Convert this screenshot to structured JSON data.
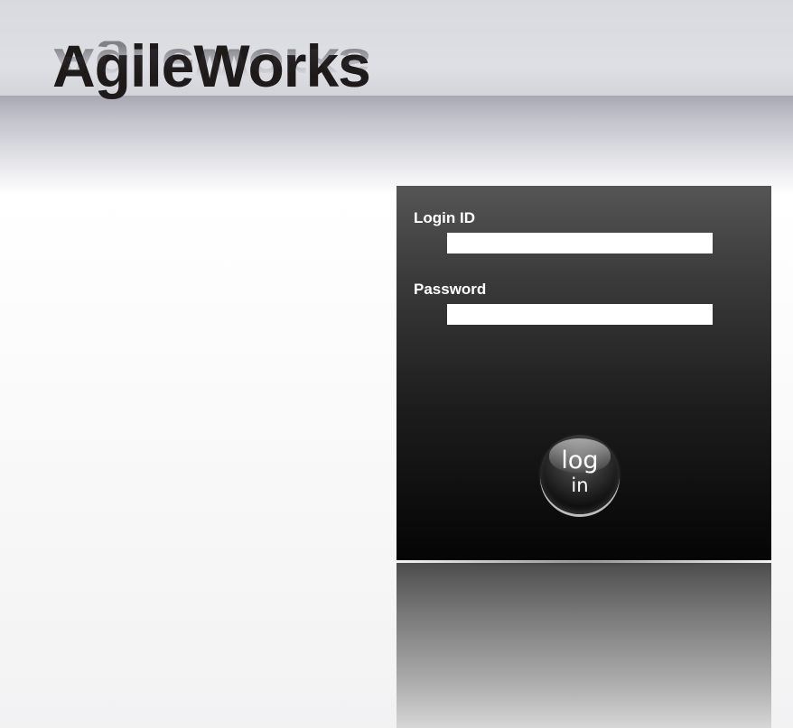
{
  "brand": {
    "name": "AgileWorks"
  },
  "login_form": {
    "login_id_label": "Login ID",
    "login_id_value": "",
    "password_label": "Password",
    "password_value": "",
    "button": {
      "line1": "log",
      "line2": "in"
    }
  }
}
